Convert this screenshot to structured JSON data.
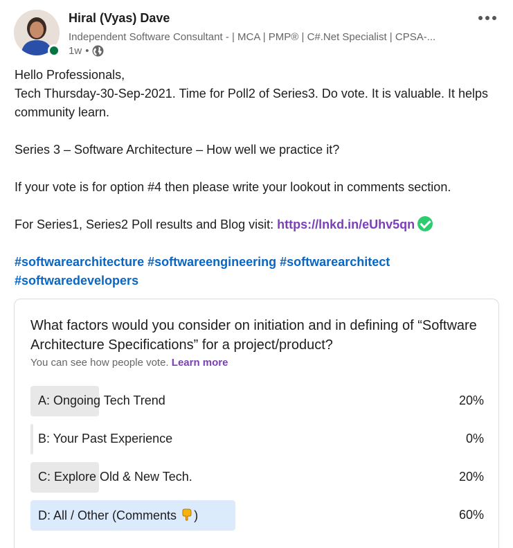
{
  "author": {
    "name": "Hiral (Vyas) Dave",
    "headline": "Independent Software Consultant - | MCA | PMP® | C#.Net Specialist | CPSA-...",
    "time": "1w",
    "separator": "•",
    "visibility_icon": "globe-icon",
    "status_color": "#057642"
  },
  "post": {
    "lines": [
      "Hello Professionals,",
      "Tech Thursday-30-Sep-2021. Time for Poll2 of Series3. Do vote. It is valuable. It helps community learn.",
      "",
      "Series 3 – Software Architecture – How well we practice it?",
      "",
      "If your vote is for option #4 then please write your lookout in comments section.",
      ""
    ],
    "blog_prefix": "For Series1, Series2 Poll results and Blog visit: ",
    "blog_link": "https://lnkd.in/eUhv5qn",
    "hashtags": [
      "#softwarearchitecture",
      "#softwareengineering",
      "#softwarearchitect",
      "#softwaredevelopers"
    ]
  },
  "poll": {
    "question": "What factors would you consider on initiation and in defining of “Software Architecture Specifications” for a project/product?",
    "subtitle": "You can see how people vote.",
    "learn_more": "Learn more",
    "options": [
      {
        "label": "A: Ongoing Tech Trend",
        "percent_text": "20%",
        "percent": 20
      },
      {
        "label": "B: Your Past Experience",
        "percent_text": "0%",
        "percent": 0
      },
      {
        "label": "C: Explore Old & New Tech.",
        "percent_text": "20%",
        "percent": 20
      },
      {
        "label": "D: All / Other (Comments",
        "suffix": ")",
        "percent_text": "60%",
        "percent": 60
      }
    ]
  },
  "colors": {
    "link": "#7b3fb8",
    "hashtag": "#0a66c2",
    "bar": "#e8e8e8",
    "bar_winner": "#dcebfb"
  }
}
